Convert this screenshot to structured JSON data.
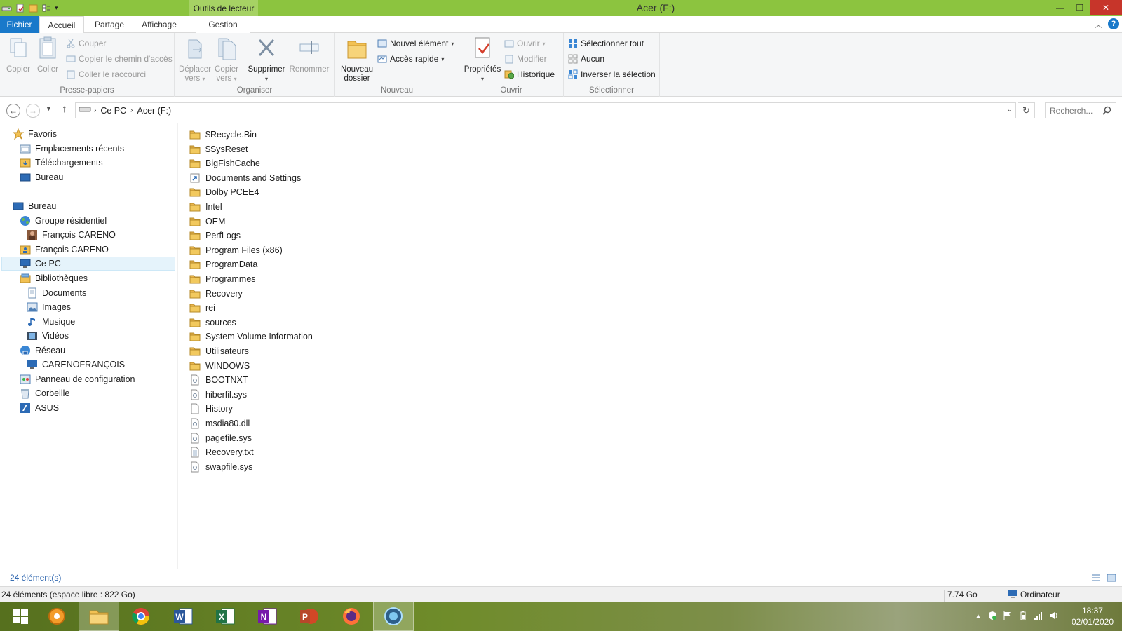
{
  "window": {
    "title": "Acer (F:)",
    "context_tab": "Outils de lecteur",
    "minimize": "—",
    "maximize": "❐",
    "close": "✕"
  },
  "ribbon_tabs": {
    "file": "Fichier",
    "home": "Accueil",
    "share": "Partage",
    "view": "Affichage",
    "manage": "Gestion",
    "help": "?"
  },
  "ribbon": {
    "clipboard": {
      "label": "Presse-papiers",
      "copy": "Copier",
      "paste": "Coller",
      "cut": "Couper",
      "copy_path": "Copier le chemin d'accès",
      "paste_shortcut": "Coller le raccourci"
    },
    "organize": {
      "label": "Organiser",
      "move_to_1": "Déplacer",
      "move_to_2": "vers",
      "copy_to_1": "Copier",
      "copy_to_2": "vers",
      "delete": "Supprimer",
      "rename": "Renommer"
    },
    "new": {
      "label": "Nouveau",
      "new_folder_1": "Nouveau",
      "new_folder_2": "dossier",
      "new_item": "Nouvel élément",
      "easy_access": "Accès rapide"
    },
    "open": {
      "label": "Ouvrir",
      "properties": "Propriétés",
      "open": "Ouvrir",
      "edit": "Modifier",
      "history": "Historique"
    },
    "select": {
      "label": "Sélectionner",
      "select_all": "Sélectionner tout",
      "select_none": "Aucun",
      "invert": "Inverser la sélection"
    }
  },
  "address": {
    "crumbs": [
      "Ce PC",
      "Acer (F:)"
    ],
    "search_placeholder": "Recherch..."
  },
  "nav_pane": [
    {
      "label": "Favoris",
      "icon": "star-icon",
      "indent": 0
    },
    {
      "label": "Emplacements récents",
      "icon": "recent-places-icon",
      "indent": 1
    },
    {
      "label": "Téléchargements",
      "icon": "downloads-folder-icon",
      "indent": 1
    },
    {
      "label": "Bureau",
      "icon": "desktop-icon",
      "indent": 1
    },
    {
      "label": "Bureau",
      "icon": "desktop-icon",
      "indent": 0
    },
    {
      "label": "Groupe résidentiel",
      "icon": "homegroup-icon",
      "indent": 1
    },
    {
      "label": "François CARENO",
      "icon": "user-photo-icon",
      "indent": 2
    },
    {
      "label": "François CARENO",
      "icon": "user-folder-icon",
      "indent": 1
    },
    {
      "label": "Ce PC",
      "icon": "computer-icon",
      "indent": 1,
      "selected": true
    },
    {
      "label": "Bibliothèques",
      "icon": "libraries-icon",
      "indent": 1
    },
    {
      "label": "Documents",
      "icon": "documents-icon",
      "indent": 2
    },
    {
      "label": "Images",
      "icon": "pictures-icon",
      "indent": 2
    },
    {
      "label": "Musique",
      "icon": "music-icon",
      "indent": 2
    },
    {
      "label": "Vidéos",
      "icon": "videos-icon",
      "indent": 2
    },
    {
      "label": "Réseau",
      "icon": "network-icon",
      "indent": 1
    },
    {
      "label": "CARENOFRANÇOIS",
      "icon": "network-computer-icon",
      "indent": 2
    },
    {
      "label": "Panneau de configuration",
      "icon": "control-panel-icon",
      "indent": 1
    },
    {
      "label": "Corbeille",
      "icon": "recycle-bin-icon",
      "indent": 1
    },
    {
      "label": "ASUS",
      "icon": "asus-icon",
      "indent": 1
    }
  ],
  "files": [
    {
      "name": "$Recycle.Bin",
      "type": "folder"
    },
    {
      "name": "$SysReset",
      "type": "folder"
    },
    {
      "name": "BigFishCache",
      "type": "folder"
    },
    {
      "name": "Documents and Settings",
      "type": "shortcut-folder"
    },
    {
      "name": "Dolby PCEE4",
      "type": "folder"
    },
    {
      "name": "Intel",
      "type": "folder"
    },
    {
      "name": "OEM",
      "type": "folder"
    },
    {
      "name": "PerfLogs",
      "type": "folder"
    },
    {
      "name": "Program Files (x86)",
      "type": "folder"
    },
    {
      "name": "ProgramData",
      "type": "folder"
    },
    {
      "name": "Programmes",
      "type": "folder"
    },
    {
      "name": "Recovery",
      "type": "folder"
    },
    {
      "name": "rei",
      "type": "folder"
    },
    {
      "name": "sources",
      "type": "folder"
    },
    {
      "name": "System Volume Information",
      "type": "folder"
    },
    {
      "name": "Utilisateurs",
      "type": "folder"
    },
    {
      "name": "WINDOWS",
      "type": "folder"
    },
    {
      "name": "BOOTNXT",
      "type": "system-file"
    },
    {
      "name": "hiberfil.sys",
      "type": "system-file"
    },
    {
      "name": "History",
      "type": "file"
    },
    {
      "name": "msdia80.dll",
      "type": "system-file"
    },
    {
      "name": "pagefile.sys",
      "type": "system-file"
    },
    {
      "name": "Recovery.txt",
      "type": "text-file"
    },
    {
      "name": "swapfile.sys",
      "type": "system-file"
    }
  ],
  "status": {
    "item_count": "24 élément(s)",
    "summary": "24 éléments (espace libre : 822 Go)",
    "size": "7.74 Go",
    "location": "Ordinateur"
  },
  "taskbar": {
    "apps": [
      "start-icon",
      "settings-app-icon",
      "file-explorer-icon",
      "chrome-icon",
      "word-icon",
      "excel-icon",
      "onenote-icon",
      "powerpoint-icon",
      "firefox-icon",
      "media-app-icon"
    ],
    "time": "18:37",
    "date": "02/01/2020"
  },
  "colors": {
    "title_bar": "#8cc43f",
    "file_tab": "#1979ca",
    "folder": "#e8b34a",
    "link": "#1e5aa8"
  }
}
